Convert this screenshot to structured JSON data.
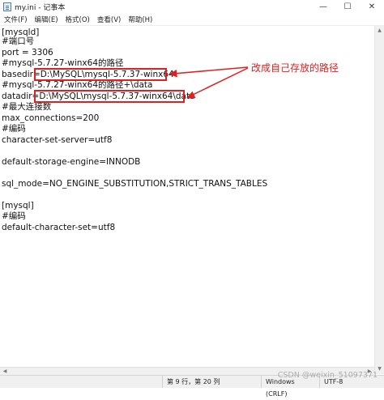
{
  "window": {
    "title": "my.ini - 记事本",
    "minimize": "—",
    "maximize": "☐",
    "close": "✕"
  },
  "menu": [
    "文件(F)",
    "编辑(E)",
    "格式(O)",
    "查看(V)",
    "帮助(H)"
  ],
  "lines": [
    "[mysqld]",
    "#端口号",
    "port = 3306",
    "#mysql-5.7.27-winx64的路径",
    "basedir=D:\\MySQL\\mysql-5.7.37-winx64",
    "#mysql-5.7.27-winx64的路径+\\data",
    "datadir=D:\\MySQL\\mysql-5.7.37-winx64\\data",
    "#最大连接数",
    "max_connections=200",
    "#编码",
    "character-set-server=utf8",
    "",
    "default-storage-engine=INNODB",
    "",
    "sql_mode=NO_ENGINE_SUBSTITUTION,STRICT_TRANS_TABLES",
    "",
    "[mysql]",
    "#编码",
    "default-character-set=utf8"
  ],
  "annotation": "改成自己存放的路径",
  "status": {
    "position": "第 9 行，第 20 列",
    "line_ending": "Windows (CRLF)",
    "encoding": "UTF-8"
  },
  "watermark": "CSDN @weixin_51097371",
  "colors": {
    "annotation": "#e02020"
  }
}
